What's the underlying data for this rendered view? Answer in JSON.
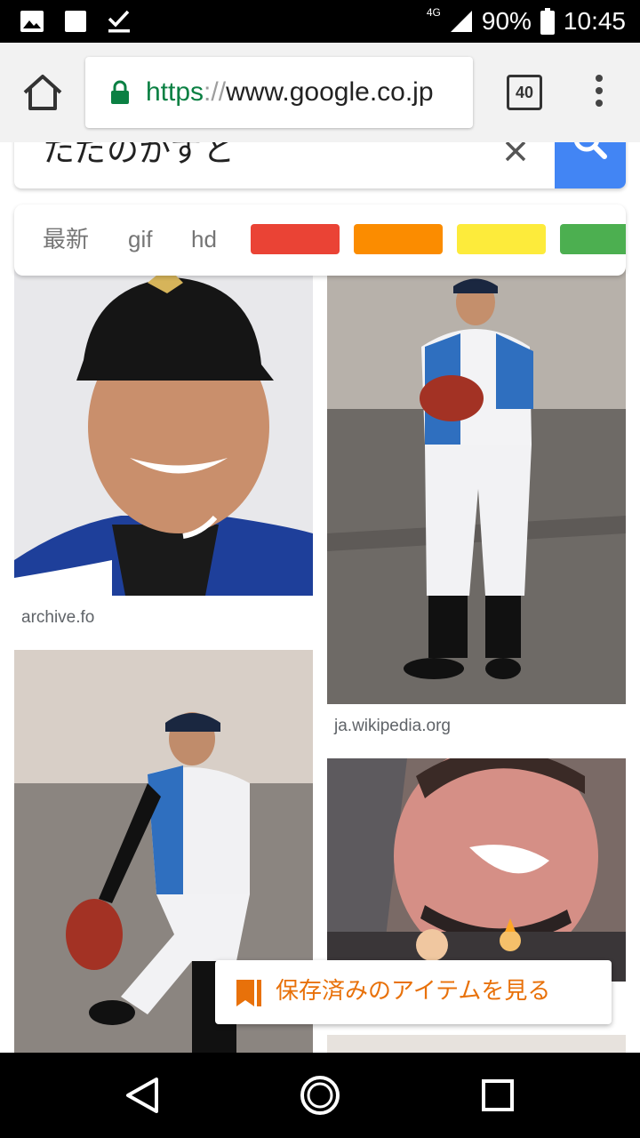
{
  "status_bar": {
    "network": "4G",
    "battery": "90%",
    "time": "10:45",
    "left_icons": [
      "image-notification-icon",
      "square-notification-icon",
      "check-download-icon"
    ]
  },
  "browser": {
    "url_scheme": "https",
    "url_separator": "://",
    "url_host": "www.google.co.jp",
    "tab_count": "40",
    "accent_secure": "#0b8043"
  },
  "search": {
    "query": "ただのかずと",
    "button_color": "#4285f4"
  },
  "filters": {
    "chips": [
      "最新",
      "gif",
      "hd"
    ],
    "colors": [
      "#ea4335",
      "#fb8c00",
      "#fdeb3b",
      "#4caf50"
    ]
  },
  "results": [
    {
      "source": "archive.fo",
      "subject": "player-headshot"
    },
    {
      "source": "ja.wikipedia.org",
      "subject": "pitcher-standing"
    },
    {
      "source": "",
      "subject": "pitcher-windup"
    },
    {
      "source": "",
      "subject": "closeup-face"
    }
  ],
  "saved_items": {
    "label": "保存済みのアイテムを見る",
    "color": "#e8710a"
  },
  "nav": [
    "back-icon",
    "home-icon",
    "recents-icon"
  ]
}
